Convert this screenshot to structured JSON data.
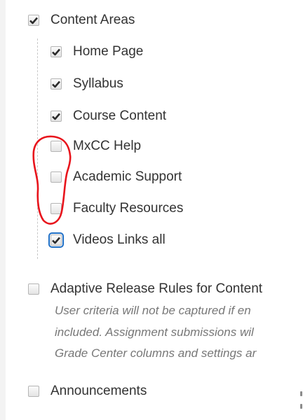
{
  "options": {
    "content_areas": {
      "label": "Content Areas",
      "checked": true
    },
    "home_page": {
      "label": "Home Page",
      "checked": true
    },
    "syllabus": {
      "label": "Syllabus",
      "checked": true
    },
    "course_content": {
      "label": "Course Content",
      "checked": true
    },
    "mxcc_help": {
      "label": "MxCC Help",
      "checked": false
    },
    "academic_support": {
      "label": "Academic Support",
      "checked": false
    },
    "faculty_resources": {
      "label": "Faculty Resources",
      "checked": false
    },
    "videos_links": {
      "label": "Videos Links all",
      "checked": true
    },
    "adaptive_release": {
      "label": "Adaptive Release Rules for Content",
      "checked": false,
      "description_lines": [
        "User criteria will not be captured if en",
        "included. Assignment submissions wil",
        "Grade Center columns and settings ar"
      ]
    },
    "announcements": {
      "label": "Announcements",
      "checked": false
    }
  },
  "annotation_color": "#e8141c",
  "focus_color": "#1f6fc5"
}
